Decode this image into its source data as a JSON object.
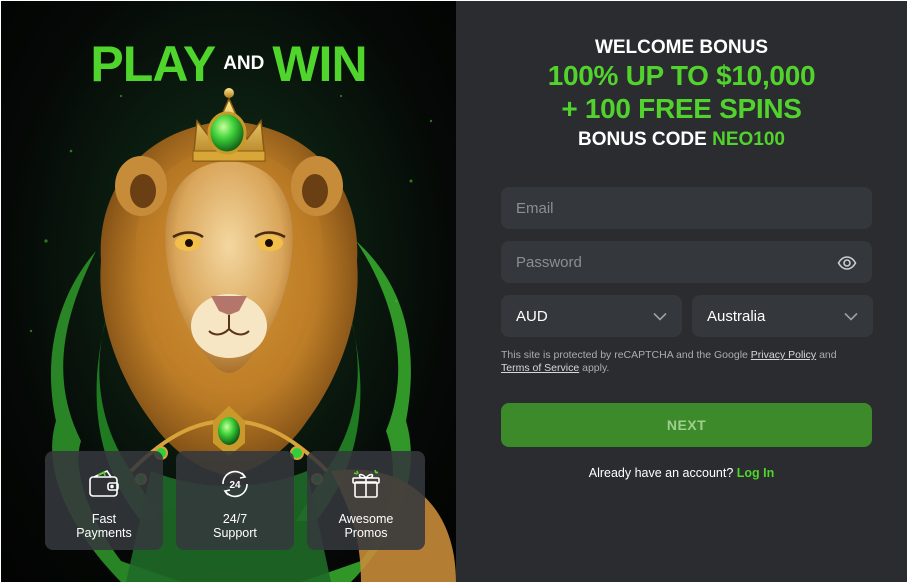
{
  "promo": {
    "headline_left": "PLAY",
    "headline_mid": "AND",
    "headline_right": "WIN",
    "features": [
      {
        "icon": "wallet-icon",
        "line1": "Fast",
        "line2": "Payments"
      },
      {
        "icon": "24-7-support-icon",
        "line1": "24/7",
        "line2": "Support"
      },
      {
        "icon": "gift-icon",
        "line1": "Awesome",
        "line2": "Promos"
      }
    ]
  },
  "bonus": {
    "welcome": "WELCOME BONUS",
    "offer_line1": "100% UP TO $10,000",
    "offer_line2": "+ 100 FREE SPINS",
    "code_label": "BONUS CODE",
    "code_value": "NEO100"
  },
  "form": {
    "email_placeholder": "Email",
    "password_placeholder": "Password",
    "currency": "AUD",
    "country": "Australia",
    "legal_prefix": "This site is protected by reCAPTCHA and the Google",
    "privacy_policy": "Privacy Policy",
    "legal_and": "and",
    "terms_of_service": "Terms of Service",
    "legal_suffix": "apply.",
    "next_label": "NEXT",
    "account_prompt": "Already have an account?",
    "login_label": "Log In"
  },
  "colors": {
    "accent": "#4fd52b",
    "button": "#3c8a2a",
    "panel_bg": "#2a2c2f",
    "field_bg": "#34373b"
  }
}
